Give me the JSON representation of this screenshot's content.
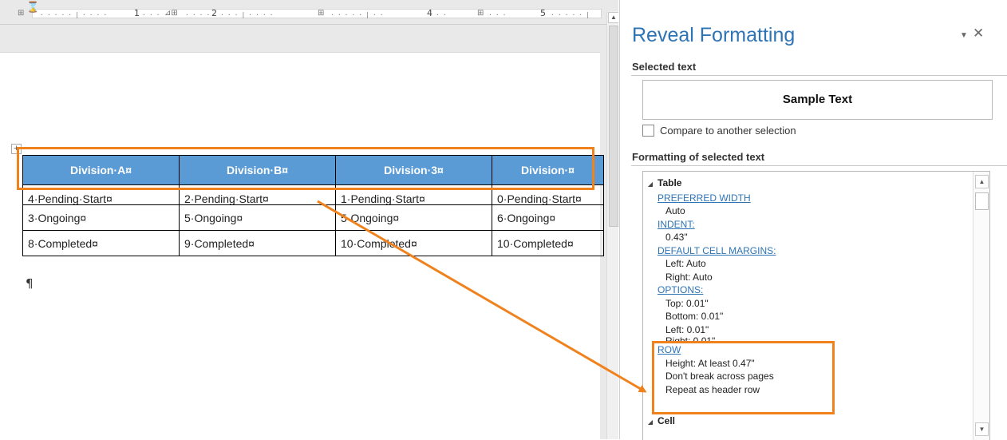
{
  "ruler": {
    "labels": [
      "1",
      "2",
      "4",
      "5"
    ]
  },
  "document": {
    "table": {
      "headers": [
        "Division·A¤",
        "Division·B¤",
        "Division·3¤",
        "Division·¤"
      ],
      "rows": [
        [
          "4·Pending·Start¤",
          "2·Pending·Start¤",
          "1·Pending·Start¤",
          "0·Pending·Start¤"
        ],
        [
          "3·Ongoing¤",
          "5·Ongoing¤",
          "5·Ongoing¤",
          "6·Ongoing¤"
        ],
        [
          "8·Completed¤",
          "9·Completed¤",
          "10·Completed¤",
          "10·Completed¤"
        ]
      ]
    },
    "pilcrow": "¶"
  },
  "panel": {
    "title": "Reveal Formatting",
    "selected_text_label": "Selected text",
    "sample_text": "Sample Text",
    "compare_label": "Compare to another selection",
    "compare_checked": false,
    "formatting_label": "Formatting of selected text",
    "sections": {
      "table": "Table",
      "cell": "Cell"
    },
    "props": {
      "preferred_width": "PREFERRED WIDTH",
      "preferred_width_val": "Auto",
      "indent": "INDENT:",
      "indent_val": "0.43\"",
      "default_cell_margins": "DEFAULT CELL MARGINS:",
      "margin_left": "Left: Auto",
      "margin_right": "Right: Auto",
      "options": "OPTIONS:",
      "opt_top": "Top: 0.01\"",
      "opt_bottom": "Bottom: 0.01\"",
      "opt_left": "Left: 0.01\"",
      "opt_right": "Right: 0.01\"",
      "row": "ROW",
      "row_height": "Height: At least 0.47\"",
      "row_break": "Don't break across pages",
      "row_repeat": "Repeat as header row"
    }
  },
  "colors": {
    "highlight": "#f0821e",
    "header_fill": "#5b9bd5",
    "link": "#2e74b5"
  },
  "icons": [
    "tab-stop-icon",
    "indent-marker-icon",
    "column-marker-icon",
    "scroll-up-icon",
    "table-move-handle-icon",
    "dropdown-icon",
    "close-icon",
    "collapse-triangle-icon",
    "scroll-down-icon"
  ]
}
